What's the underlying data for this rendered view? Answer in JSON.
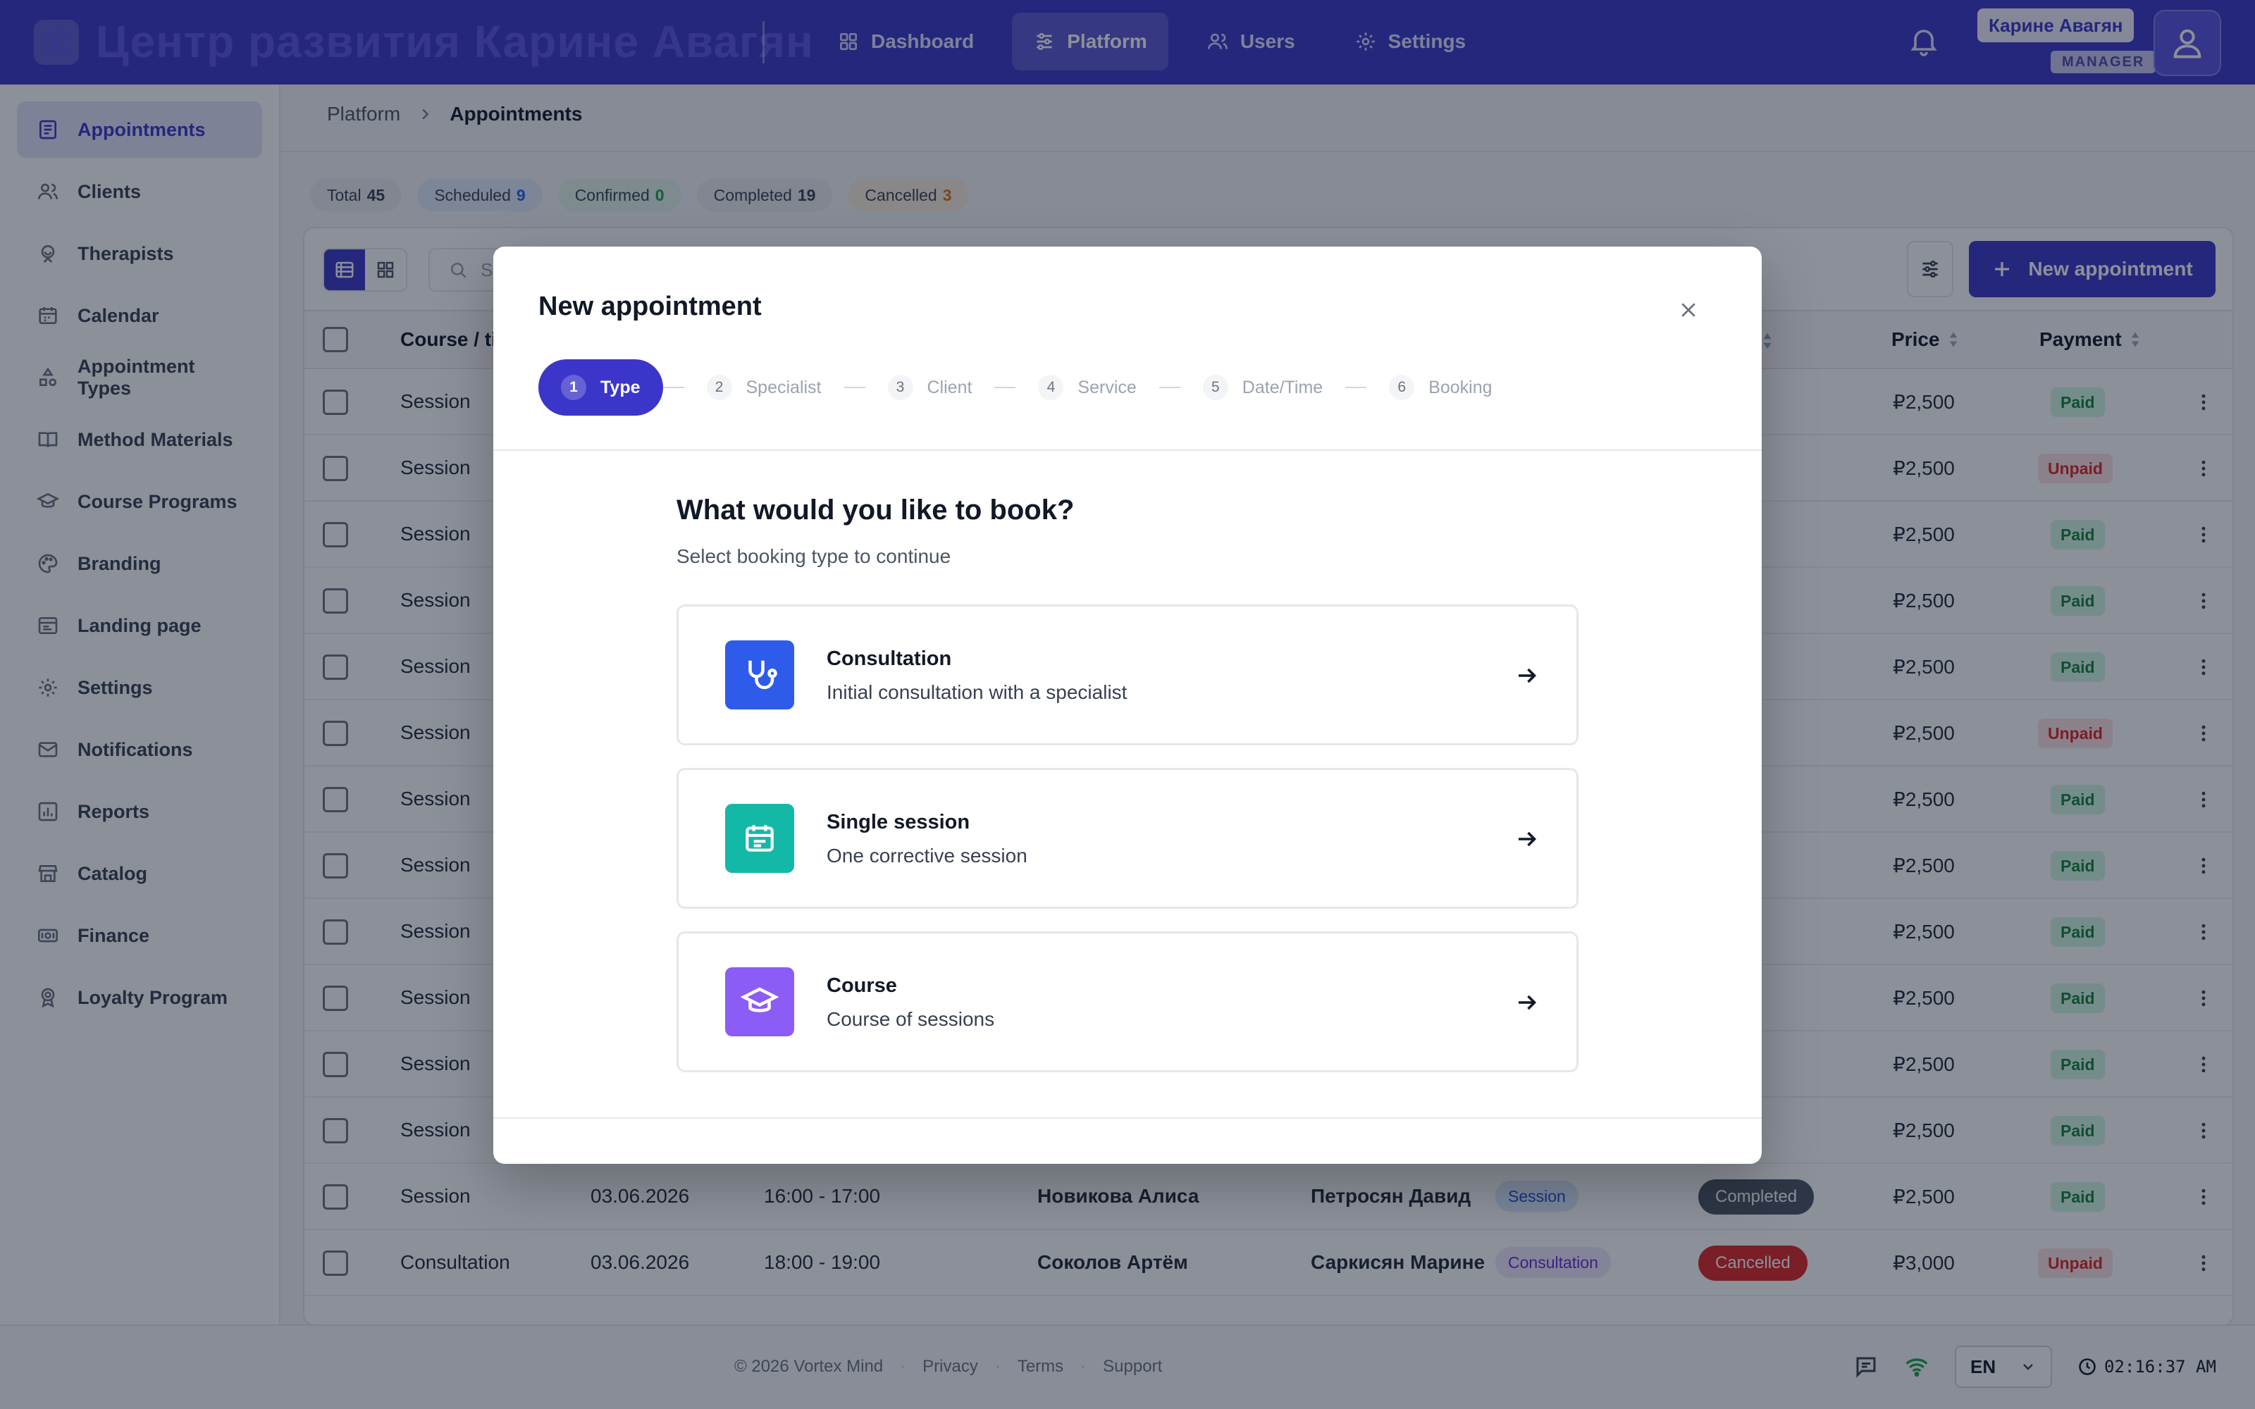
{
  "header": {
    "brand": "Центр развития Карине Авагян",
    "nav": [
      {
        "label": "Dashboard",
        "icon": "grid-icon"
      },
      {
        "label": "Platform",
        "icon": "sliders-icon"
      },
      {
        "label": "Users",
        "icon": "users-icon"
      },
      {
        "label": "Settings",
        "icon": "gear-icon"
      }
    ],
    "active_nav": "Platform",
    "user_name": "Карине Авагян",
    "user_role": "MANAGER"
  },
  "sidebar": {
    "items": [
      {
        "label": "Appointments",
        "icon": "calendar-list-icon"
      },
      {
        "label": "Clients",
        "icon": "users-icon"
      },
      {
        "label": "Therapists",
        "icon": "therapist-icon"
      },
      {
        "label": "Calendar",
        "icon": "calendar-icon"
      },
      {
        "label": "Appointment Types",
        "icon": "shapes-icon"
      },
      {
        "label": "Method Materials",
        "icon": "book-icon"
      },
      {
        "label": "Course Programs",
        "icon": "graduation-cap-icon"
      },
      {
        "label": "Branding",
        "icon": "palette-icon"
      },
      {
        "label": "Landing page",
        "icon": "browser-icon"
      },
      {
        "label": "Settings",
        "icon": "gear-icon"
      },
      {
        "label": "Notifications",
        "icon": "mail-icon"
      },
      {
        "label": "Reports",
        "icon": "bar-chart-icon"
      },
      {
        "label": "Catalog",
        "icon": "store-icon"
      },
      {
        "label": "Finance",
        "icon": "money-icon"
      },
      {
        "label": "Loyalty Program",
        "icon": "award-icon"
      }
    ],
    "active": "Appointments"
  },
  "breadcrumb": {
    "parent": "Platform",
    "current": "Appointments"
  },
  "stats": [
    {
      "label": "Total",
      "value": "45",
      "kind": "total"
    },
    {
      "label": "Scheduled",
      "value": "9",
      "kind": "scheduled"
    },
    {
      "label": "Confirmed",
      "value": "0",
      "kind": "confirmed"
    },
    {
      "label": "Completed",
      "value": "19",
      "kind": "completed"
    },
    {
      "label": "Cancelled",
      "value": "3",
      "kind": "cancelled"
    }
  ],
  "toolbar": {
    "search_placeholder": "S",
    "new_button": "New appointment"
  },
  "table": {
    "columns": {
      "course": "Course / ti",
      "price": "Price",
      "payment": "Payment"
    },
    "rows": [
      {
        "course": "Session",
        "status": "eted",
        "status_kind": "completed",
        "price": "₽2,500",
        "payment": "Paid"
      },
      {
        "course": "Session",
        "status": "ow",
        "status_kind": "noshow",
        "price": "₽2,500",
        "payment": "Unpaid"
      },
      {
        "course": "Session",
        "status": "eted",
        "status_kind": "completed",
        "price": "₽2,500",
        "payment": "Paid"
      },
      {
        "course": "Session",
        "status": "ow",
        "status_kind": "noshow",
        "price": "₽2,500",
        "payment": "Paid"
      },
      {
        "course": "Session",
        "status": "eted",
        "status_kind": "completed",
        "price": "₽2,500",
        "payment": "Paid"
      },
      {
        "course": "Session",
        "status": "ow",
        "status_kind": "noshow",
        "price": "₽2,500",
        "payment": "Unpaid"
      },
      {
        "course": "Session",
        "status": "eted",
        "status_kind": "completed",
        "price": "₽2,500",
        "payment": "Paid"
      },
      {
        "course": "Session",
        "status": "eted",
        "status_kind": "completed",
        "price": "₽2,500",
        "payment": "Paid"
      },
      {
        "course": "Session",
        "status": "eted",
        "status_kind": "completed",
        "price": "₽2,500",
        "payment": "Paid"
      },
      {
        "course": "Session",
        "status": "eted",
        "status_kind": "completed",
        "price": "₽2,500",
        "payment": "Paid"
      },
      {
        "course": "Session",
        "status": "eted",
        "status_kind": "completed",
        "price": "₽2,500",
        "payment": "Paid"
      },
      {
        "course": "Session",
        "status": "eted",
        "status_kind": "completed",
        "price": "₽2,500",
        "payment": "Paid"
      },
      {
        "course": "Session",
        "date": "03.06.2026",
        "time": "16:00 - 17:00",
        "client": "Новикова Алиса",
        "therapist": "Петросян Давид",
        "type": "Session",
        "type_kind": "session",
        "status": "Completed",
        "status_kind": "completed",
        "price": "₽2,500",
        "payment": "Paid"
      },
      {
        "course": "Consultation",
        "date": "03.06.2026",
        "time": "18:00 - 19:00",
        "client": "Соколов Артём",
        "therapist": "Саркисян Марине",
        "type": "Consultation",
        "type_kind": "consultation",
        "status": "Cancelled",
        "status_kind": "cancelled",
        "price": "₽3,000",
        "payment": "Unpaid"
      }
    ]
  },
  "footer": {
    "copyright": "© 2026 Vortex Mind",
    "links": [
      "Privacy",
      "Terms",
      "Support"
    ],
    "language": "EN",
    "time": "02:16:37 AM"
  },
  "modal": {
    "title": "New appointment",
    "steps": [
      {
        "num": "1",
        "label": "Type"
      },
      {
        "num": "2",
        "label": "Specialist"
      },
      {
        "num": "3",
        "label": "Client"
      },
      {
        "num": "4",
        "label": "Service"
      },
      {
        "num": "5",
        "label": "Date/Time"
      },
      {
        "num": "6",
        "label": "Booking"
      }
    ],
    "active_step": 1,
    "question": "What would you like to book?",
    "subtitle": "Select booking type to continue",
    "options": [
      {
        "title": "Consultation",
        "description": "Initial consultation with a specialist",
        "icon": "stethoscope-icon",
        "color": "#2f5bea"
      },
      {
        "title": "Single session",
        "description": "One corrective session",
        "icon": "calendar-icon",
        "color": "#14b8a6"
      },
      {
        "title": "Course",
        "description": "Course of sessions",
        "icon": "graduation-cap-icon",
        "color": "#8b5cf6"
      }
    ]
  },
  "colors": {
    "accent": "#3b36c9",
    "paid": "#15803d",
    "unpaid": "#dc2626"
  }
}
